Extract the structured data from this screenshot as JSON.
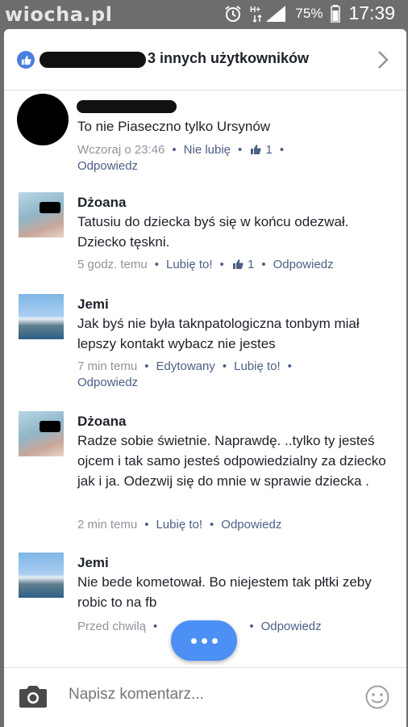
{
  "status_bar": {
    "watermark": "wiocha.pl",
    "battery": "75%",
    "time": "17:39"
  },
  "header": {
    "title": "3 innych użytkowników"
  },
  "comments": [
    {
      "name": "",
      "text": "To nie Piaseczno tylko Ursynów",
      "time": "Wczoraj o 23:46",
      "actions": [
        "Nie lubię",
        "Odpowiedz"
      ],
      "likes": "1"
    },
    {
      "name": "Dżoana",
      "text": "Tatusiu do dziecka byś się w końcu odezwał.  Dziecko tęskni.",
      "time": "5 godz. temu",
      "actions": [
        "Lubię to!",
        "Odpowiedz"
      ],
      "likes": "1"
    },
    {
      "name": "Jemi",
      "text": "Jak byś nie była taknpatologiczna tonbym miał lepszy kontakt wybacz nie jestes",
      "time": "7 min temu",
      "actions": [
        "Edytowany",
        "Lubię to!",
        "Odpowiedz"
      ]
    },
    {
      "name": "Dżoana",
      "text": "Radze sobie świetnie.  Naprawdę. ..tylko ty jesteś ojcem i tak samo jesteś odpowiedzialny za dziecko jak i ja. Odezwij się do mnie w sprawie dziecka .",
      "time": "2 min temu",
      "actions": [
        "Lubię to!",
        "Odpowiedz"
      ]
    },
    {
      "name": "Jemi",
      "text": "Nie bede kometował. Bo niejestem tak płtki zeby robic to na fb",
      "time": "Przed chwilą",
      "actions": [
        "Odpowiedz"
      ]
    }
  ],
  "composer": {
    "placeholder": "Napisz komentarz..."
  },
  "icons": {
    "like_badge": "thumbs-up-icon",
    "chevron": "chevron-right-icon",
    "camera": "camera-icon",
    "emoji": "smiley-icon",
    "more": "more-dots-icon"
  },
  "colors": {
    "accent": "#4b5e86",
    "fb_blue": "#4c8ff5",
    "meta_gray": "#90949c",
    "text": "#1d2129"
  }
}
